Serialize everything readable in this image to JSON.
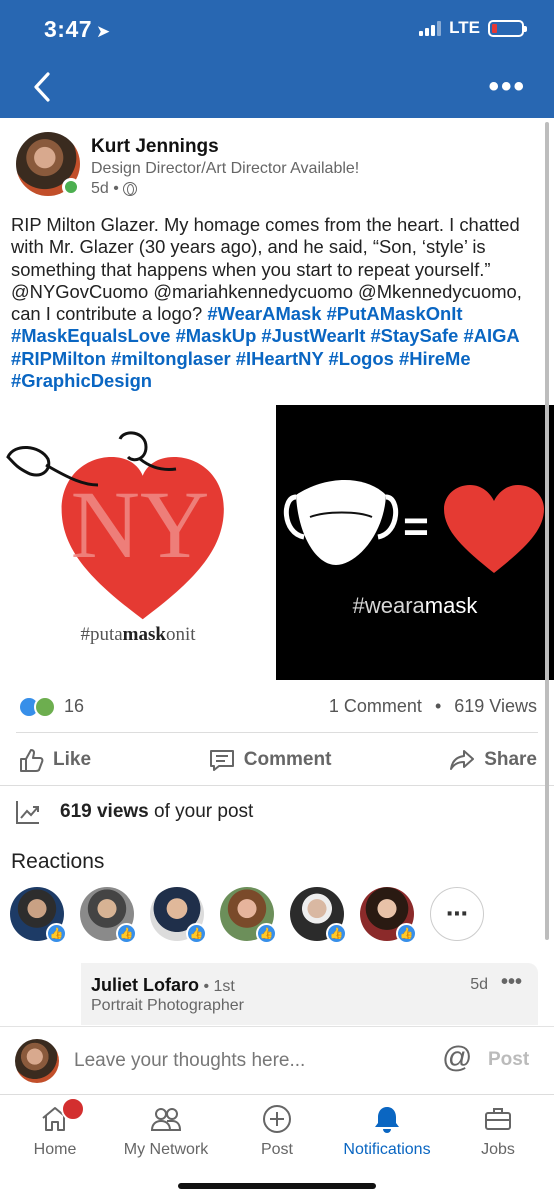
{
  "status_bar": {
    "time": "3:47",
    "network": "LTE"
  },
  "post": {
    "author": {
      "name": "Kurt Jennings",
      "headline": "Design Director/Art Director Available!",
      "age": "5d •"
    },
    "body": "RIP Milton Glazer. My homage comes from the heart. I chatted with Mr. Glazer (30 years ago), and he said, “Son, ‘style’ is something that happens when you start to repeat yourself.” @NYGovCuomo @mariahkennedycuomo @Mkennedycuomo, can I contribute a logo? ",
    "hashtags": "#WearAMask #PutAMaskOnIt #MaskEqualsLove #MaskUp #JustWearIt #StaySafe #AIGA #RIPMilton #miltonglaser  #IHeartNY #Logos #HireMe #GraphicDesign",
    "images": {
      "left_caption_prefix": "#puta",
      "left_caption_bold": "mask",
      "left_caption_suffix": "onit",
      "left_heart_text": "NY",
      "left_equals": "=",
      "right_caption_prefix": "#weara",
      "right_caption_bold": "mask"
    },
    "reaction_count": "16",
    "comments": "1 Comment",
    "views_summary": "619 Views",
    "comments_views_separator": "•"
  },
  "actions": {
    "like": "Like",
    "comment": "Comment",
    "share": "Share"
  },
  "views_line": {
    "count": "619 views",
    "suffix": " of your post"
  },
  "reactions_section": {
    "title": "Reactions",
    "more": "⋯"
  },
  "comment_preview": {
    "name": "Juliet Lofaro",
    "degree": " • 1st",
    "headline": "Portrait Photographer",
    "time": "5d"
  },
  "comment_box": {
    "placeholder": "Leave your thoughts here...",
    "mention": "@",
    "post": "Post"
  },
  "tabbar": {
    "home": "Home",
    "network": "My Network",
    "post": "Post",
    "notifications": "Notifications",
    "jobs": "Jobs",
    "active": "notifications"
  },
  "colors": {
    "header": "#2867b2",
    "link": "#0a66c2",
    "heart": "#e53a33",
    "badge": "#d32f2f"
  }
}
